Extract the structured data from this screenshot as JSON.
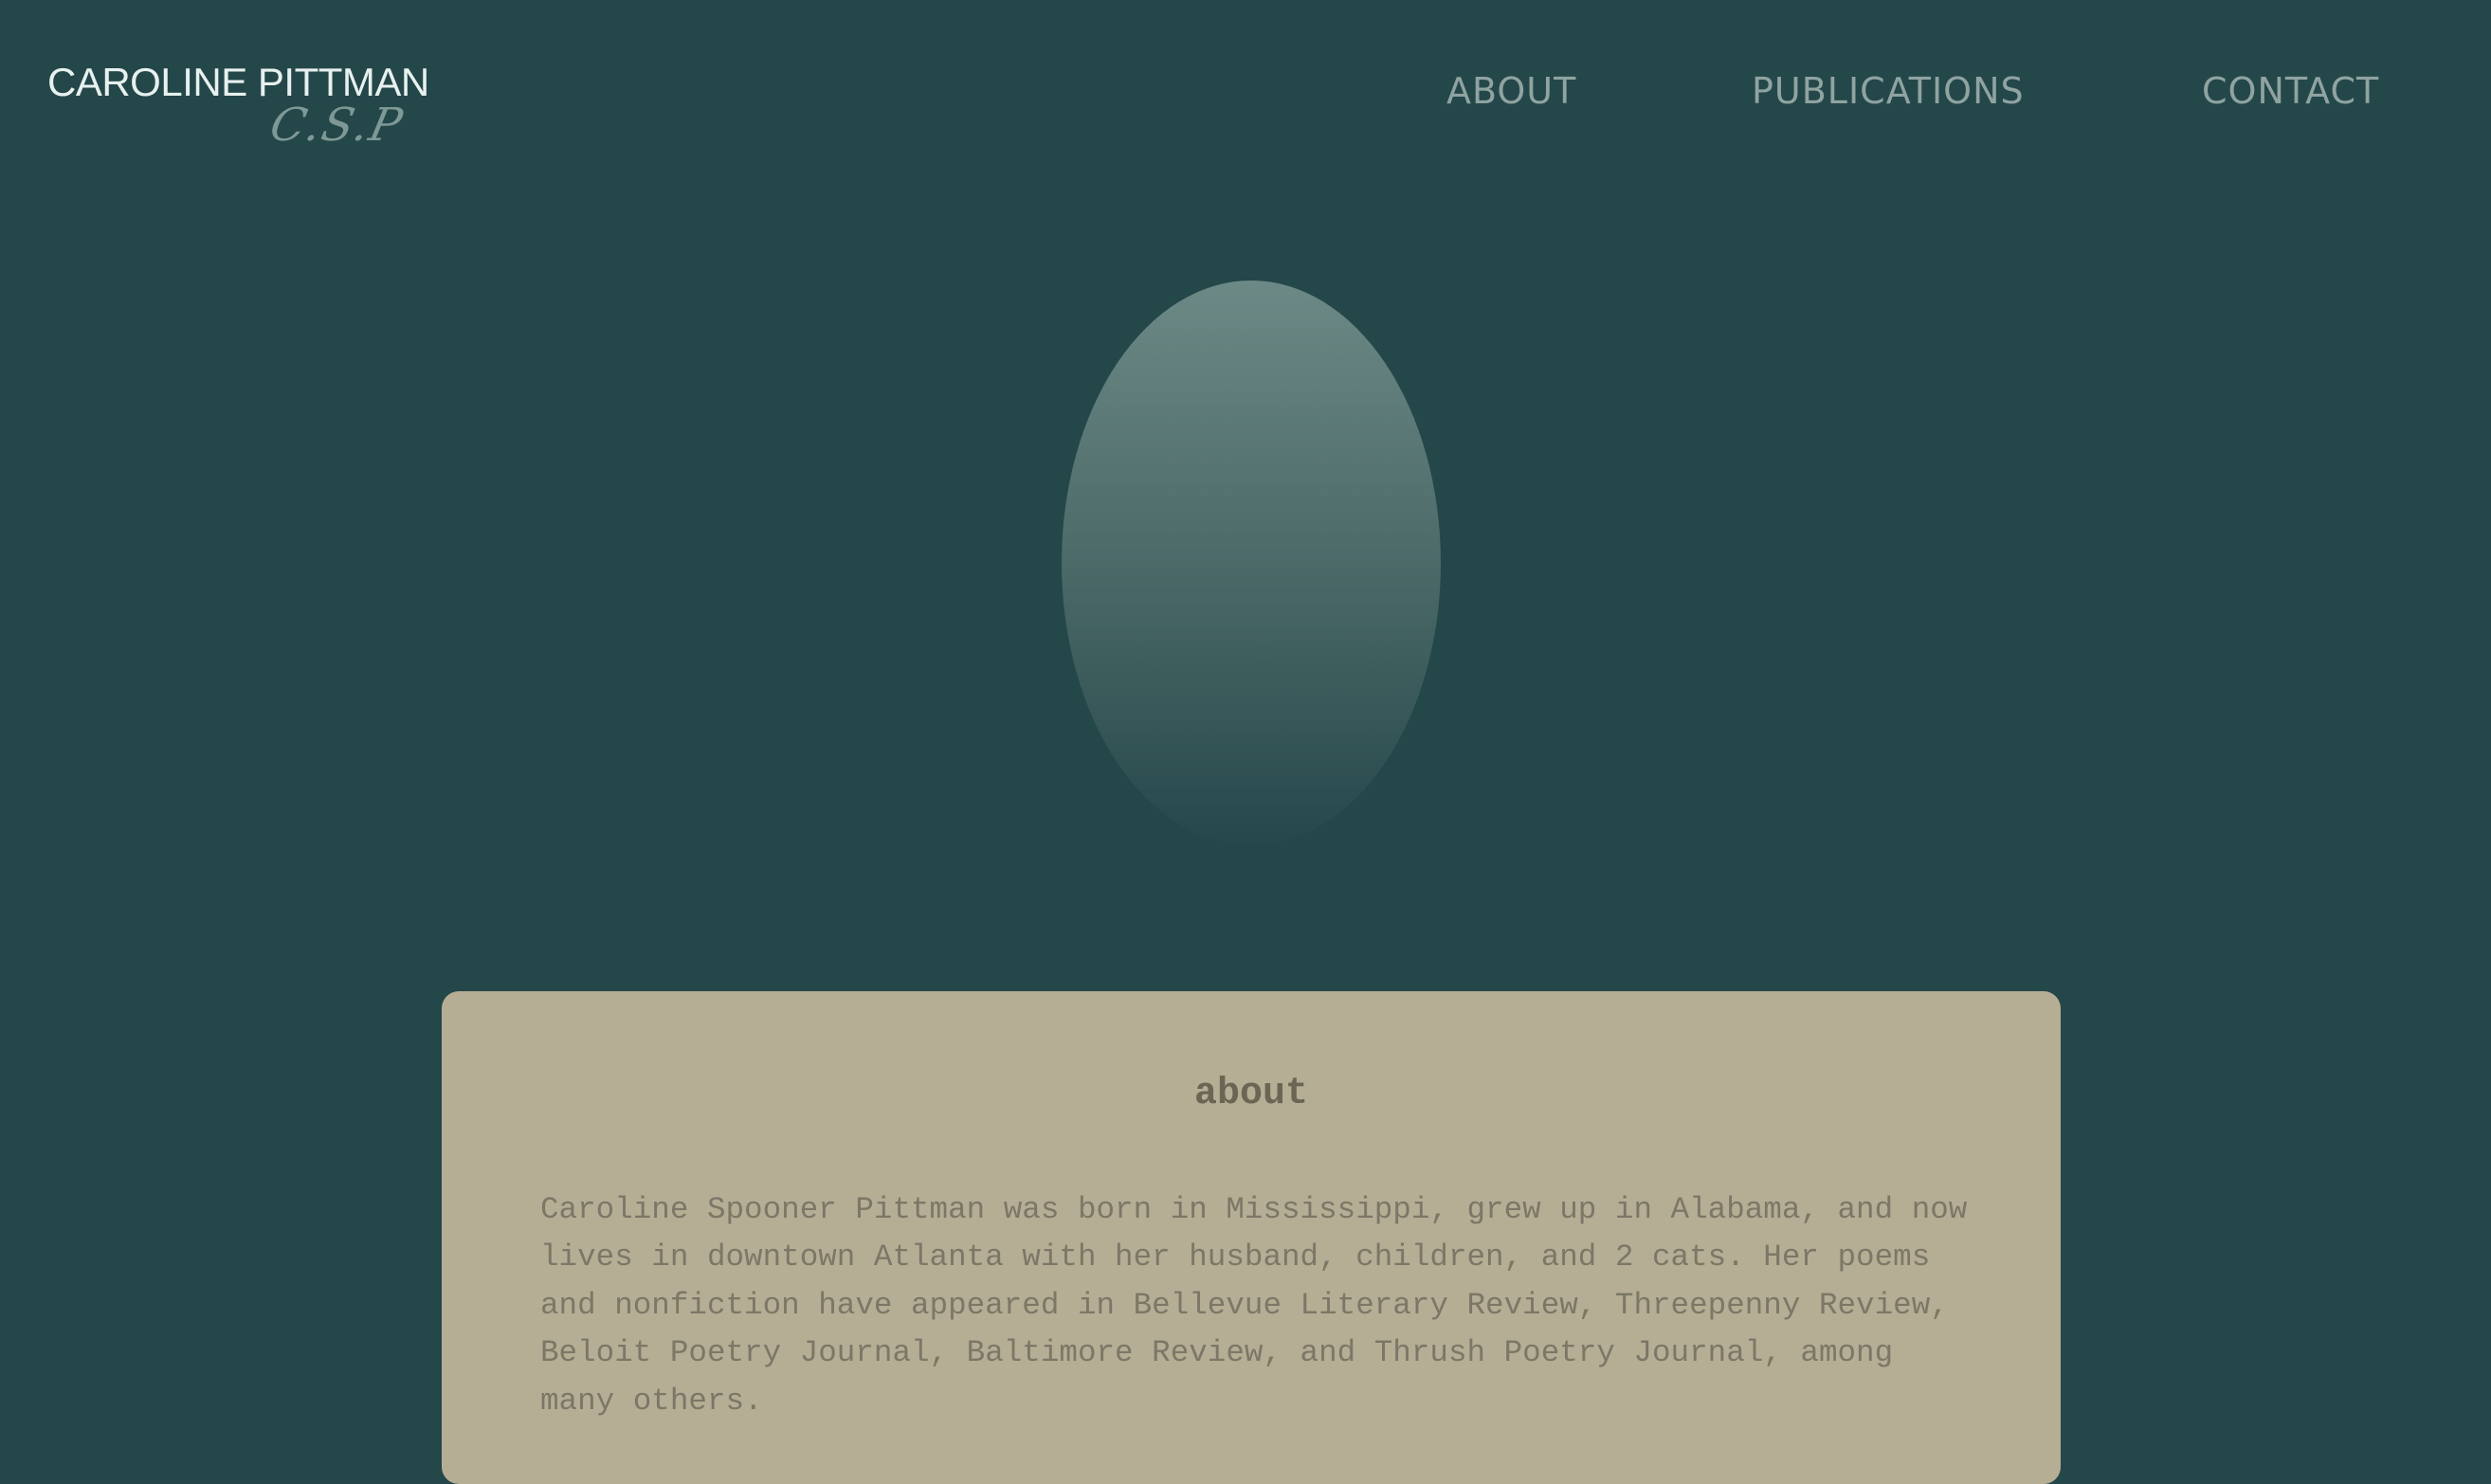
{
  "site": {
    "name": "CAROLINE PITTMAN",
    "monogram": "C.S.P"
  },
  "nav": {
    "items": [
      {
        "label": "ABOUT"
      },
      {
        "label": "PUBLICATIONS"
      },
      {
        "label": "CONTACT"
      }
    ]
  },
  "portrait": {
    "image": "portrait-photo"
  },
  "about": {
    "title": "about",
    "body": "Caroline Spooner Pittman was born in Mississippi, grew up in Alabama, and now lives in downtown Atlanta with her husband, children, and 2 cats. Her poems and nonfiction have appeared in Bellevue Literary Review, Threepenny Review, Beloit Poetry Journal, Baltimore Review, and Thrush Poetry Journal, among many others."
  },
  "colors": {
    "background": "#24474a",
    "card": "#b6ad95",
    "nav_text": "#8fa3a1",
    "logo_text": "#e8f1ef",
    "heading_text": "#6b6654",
    "body_text": "#7c7766"
  }
}
